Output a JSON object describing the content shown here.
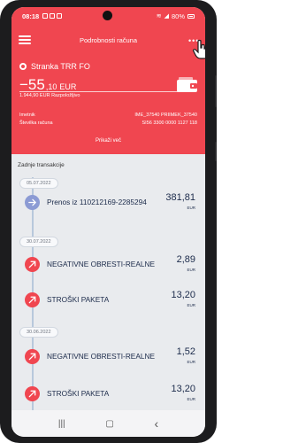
{
  "status_bar": {
    "time": "08:18",
    "battery": "80%"
  },
  "header": {
    "title": "Podrobnosti računa",
    "account_name": "Stranka TRR FO",
    "balance_int": "−55",
    "balance_dec": ",10",
    "balance_currency": "EUR",
    "available": "1.944,90 EUR Razpoložljivo",
    "info": [
      {
        "label": "Imetnik",
        "value": "IME_37540 PRIIMEK_37540"
      },
      {
        "label": "Številka računa",
        "value": "SI56 3300 0000 1127 118"
      }
    ],
    "show_more": "Prikaži več"
  },
  "transactions": {
    "section_title": "Zadnje transakcije",
    "groups": [
      {
        "date": "05.07.2022",
        "items": [
          {
            "name": "Prenos iz 110212169-2285294",
            "amount": "381,81",
            "currency": "EUR",
            "icon": "incoming-transfer-icon"
          }
        ]
      },
      {
        "date": "30.07.2022",
        "items": [
          {
            "name": "NEGATIVNE OBRESTI-REALNE",
            "amount": "2,89",
            "currency": "EUR",
            "icon": "outgoing-payment-icon"
          },
          {
            "name": "STROŠKI PAKETA",
            "amount": "13,20",
            "currency": "EUR",
            "icon": "outgoing-payment-icon"
          }
        ]
      },
      {
        "date": "30.06.2022",
        "items": [
          {
            "name": "NEGATIVNE OBRESTI-REALNE",
            "amount": "1,52",
            "currency": "EUR",
            "icon": "outgoing-payment-icon"
          },
          {
            "name": "STROŠKI PAKETA",
            "amount": "13,20",
            "currency": "EUR",
            "icon": "outgoing-payment-icon"
          }
        ]
      }
    ]
  },
  "nav": {
    "recents": "|||",
    "home": "▢",
    "back": "‹"
  },
  "colors": {
    "brand": "#f04650",
    "incoming": "#8c9bd4",
    "outgoing": "#f04650",
    "text": "#1b2a4a"
  }
}
